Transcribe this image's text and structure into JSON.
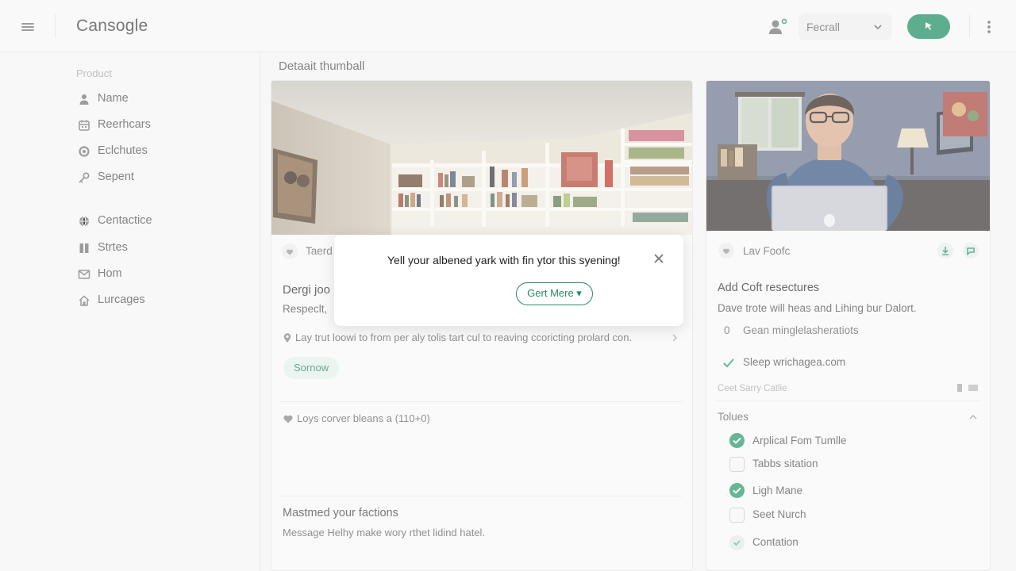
{
  "header": {
    "brand": "Cansogle",
    "select_value": "Fecrall"
  },
  "sidebar": {
    "section_label": "Product",
    "items": [
      {
        "label": "Name",
        "icon": "person-icon"
      },
      {
        "label": "Reerhcars",
        "icon": "calendar-icon"
      },
      {
        "label": "Eclchutes",
        "icon": "circle-badge-icon"
      },
      {
        "label": "Sepent",
        "icon": "key-icon"
      },
      {
        "label": "Centactice",
        "icon": "globe-icon"
      },
      {
        "label": "Strtes",
        "icon": "columns-icon"
      },
      {
        "label": "Hom",
        "icon": "mail-icon"
      },
      {
        "label": "Lurcages",
        "icon": "home-icon"
      }
    ]
  },
  "main": {
    "title": "Detaait thumball",
    "card1": {
      "meta_label": "Taerd",
      "heading": "Dergi joo",
      "subtext": "Respeclt, ",
      "location_text": "Lay trut loowi to from per aly tolis tart cul to reaving ccoricting prolard con.",
      "chip": "Sornow",
      "likes_text": "Loys corver bleans a (110+0)",
      "section2_heading": "Mastmed your factions",
      "section2_text": "Message Helhy make wory rthet lidind hatel."
    },
    "card2": {
      "meta_label": "Lav Foofc",
      "heading": "Add Coft resectures",
      "subtext": "Dave trote will heas and Lihing bur Dalort.",
      "counter_value": "0",
      "counter_text": "Gean minglelasheratiots",
      "verified_text": "Sleep wrichagea.com",
      "footnote": "Ceet Sarry Catlie",
      "list_title": "Tolues",
      "checklist": [
        {
          "label": "Arplical Fom Tumlle",
          "state": "on"
        },
        {
          "label": "Tabbs sitation",
          "state": "off"
        },
        {
          "label": "Ligh Mane",
          "state": "on"
        },
        {
          "label": "Seet Nurch",
          "state": "off"
        },
        {
          "label": "Contation",
          "state": "soft"
        }
      ]
    }
  },
  "modal": {
    "message": "Yell your albened yark with fin ytor this syening!",
    "button": "Gert Mere ▾"
  },
  "colors": {
    "accent": "#1f8f63",
    "chip_bg": "#e3f2eb",
    "background": "#f4f4f4"
  }
}
